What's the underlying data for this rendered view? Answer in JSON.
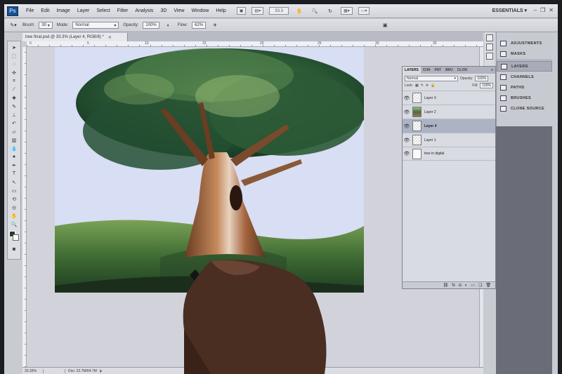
{
  "app": {
    "logo": "Ps",
    "workspace": "ESSENTIALS"
  },
  "menu": [
    "File",
    "Edit",
    "Image",
    "Layer",
    "Select",
    "Filter",
    "Analysis",
    "3D",
    "View",
    "Window",
    "Help"
  ],
  "menubar": {
    "zoom": "33.3"
  },
  "options": {
    "brush_label": "Brush:",
    "brush_size": "30",
    "mode_label": "Mode:",
    "mode_value": "Normal",
    "opacity_label": "Opacity:",
    "opacity_value": "100%",
    "flow_label": "Flow:",
    "flow_value": "62%"
  },
  "document": {
    "tab_title": "tree final.psd @ 33.3% (Layer 4, RGB/8) *"
  },
  "ruler_ticks": [
    "0",
    "5",
    "10",
    "15",
    "20",
    "25",
    "30",
    "35",
    "40"
  ],
  "status": {
    "zoom": "33.33%",
    "doc": "Doc: 22.7M/64.7M"
  },
  "collapsed_panels": {
    "top": [
      {
        "label": "ADJUSTMENTS",
        "icon": "adjustments-icon"
      },
      {
        "label": "MASKS",
        "icon": "masks-icon"
      }
    ],
    "bottom": [
      {
        "label": "LAYERS",
        "icon": "layers-icon"
      },
      {
        "label": "CHANNELS",
        "icon": "channels-icon"
      },
      {
        "label": "PATHS",
        "icon": "paths-icon"
      },
      {
        "label": "BRUSHES",
        "icon": "brushes-icon"
      },
      {
        "label": "CLONE SOURCE",
        "icon": "clone-source-icon"
      }
    ]
  },
  "layers_panel": {
    "tabs": [
      "LAYERS",
      "CHA",
      "PAT",
      "BRU",
      "CLON"
    ],
    "blend_mode": "Normal",
    "opacity_label": "Opacity:",
    "opacity_value": "100%",
    "lock_label": "Lock:",
    "fill_label": "Fill:",
    "fill_value": "100%",
    "layers": [
      {
        "name": "Layer 3",
        "selected": false,
        "thumb": "transparent"
      },
      {
        "name": "Layer 2",
        "selected": false,
        "thumb": "tree"
      },
      {
        "name": "Layer 4",
        "selected": true,
        "thumb": "transparent"
      },
      {
        "name": "Layer 1",
        "selected": false,
        "thumb": "transparent"
      },
      {
        "name": "tree in digital",
        "selected": false,
        "thumb": "white"
      }
    ]
  },
  "colors": {
    "foreground": "#2a3a2c",
    "background": "#ffffff",
    "accent": "#1c4f8f"
  }
}
